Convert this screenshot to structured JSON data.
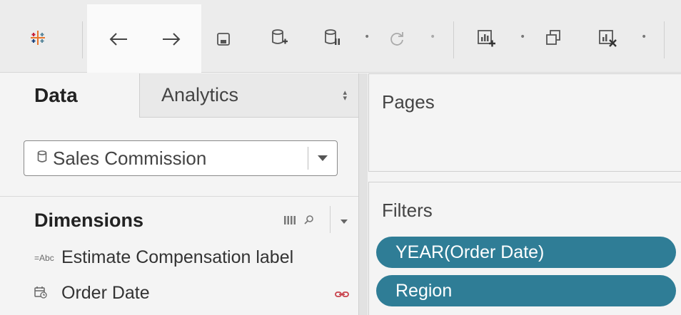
{
  "toolbar": {
    "icons": [
      "tableau-logo-icon",
      "back-arrow-icon",
      "forward-arrow-icon",
      "save-icon",
      "new-data-source-icon",
      "pause-data-icon",
      "refresh-icon",
      "new-worksheet-icon",
      "duplicate-sheet-icon",
      "clear-sheet-icon"
    ],
    "colors": {
      "logo": [
        "#e8762d",
        "#c72037",
        "#5b879b",
        "#1f457e",
        "#59879b"
      ]
    }
  },
  "tabs": {
    "data_label": "Data",
    "analytics_label": "Analytics"
  },
  "data_source": {
    "selected": "Sales Commission"
  },
  "dimensions": {
    "title": "Dimensions",
    "fields": [
      {
        "icon": "Abc",
        "label": "Estimate Compensation label"
      },
      {
        "icon": "calendar-icon",
        "label": "Order Date"
      }
    ]
  },
  "pages": {
    "title": "Pages"
  },
  "filters": {
    "title": "Filters",
    "pills": [
      "YEAR(Order Date)",
      "Region"
    ],
    "pill_color": "#2f7d96"
  }
}
